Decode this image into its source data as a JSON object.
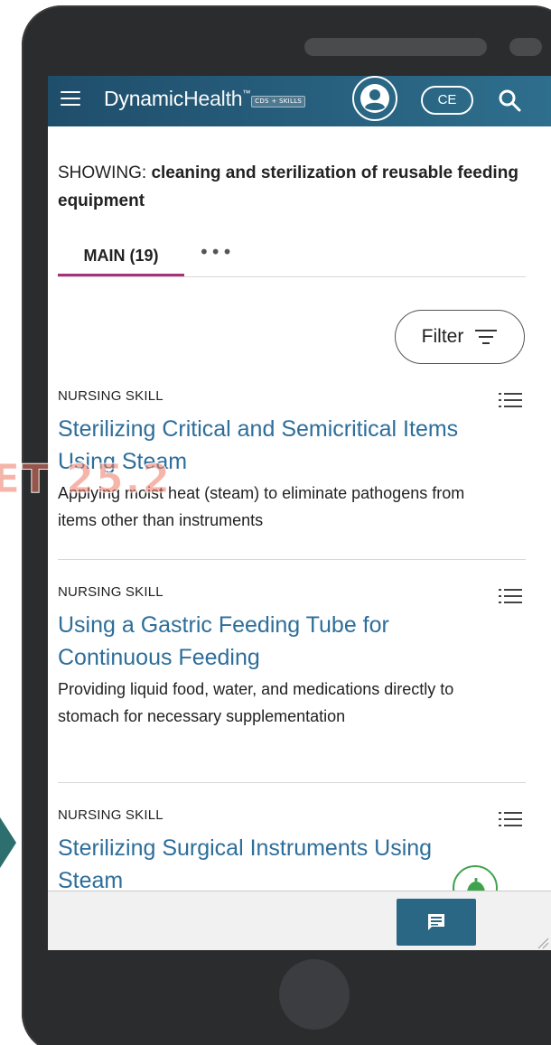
{
  "header": {
    "brand_primary": "Dynamic",
    "brand_secondary": "Health",
    "brand_tm": "™",
    "brand_tag": "CDS + SKILLS",
    "ce_label": "CE"
  },
  "search": {
    "showing_prefix": "SHOWING:",
    "query": "cleaning and sterilization of reusable feeding equipment"
  },
  "tabs": {
    "main_label": "MAIN (19)",
    "more_label": "•••"
  },
  "filter": {
    "label": "Filter"
  },
  "results": [
    {
      "category": "NURSING SKILL",
      "title": "Sterilizing Critical and Semicritical Items Using Steam",
      "description": "Applying moist heat (steam) to eliminate pathogens from items other than instruments"
    },
    {
      "category": "NURSING SKILL",
      "title": "Using a Gastric Feeding Tube for Continuous Feeding",
      "description": "Providing liquid food, water, and medications directly to stomach for necessary supplementation"
    },
    {
      "category": "NURSING SKILL",
      "title": "Sterilizing Surgical Instruments Using Steam",
      "description": ""
    }
  ],
  "overlay": {
    "watermark": "ET 25.2"
  },
  "colors": {
    "header_bg": "#27607e",
    "link": "#2d6e9a",
    "tab_underline": "#a8317b",
    "notification_green": "#3fa34d"
  },
  "icons": [
    "menu-icon",
    "user-icon",
    "search-icon",
    "list-icon",
    "filter-icon",
    "chat-icon",
    "bell-icon"
  ]
}
